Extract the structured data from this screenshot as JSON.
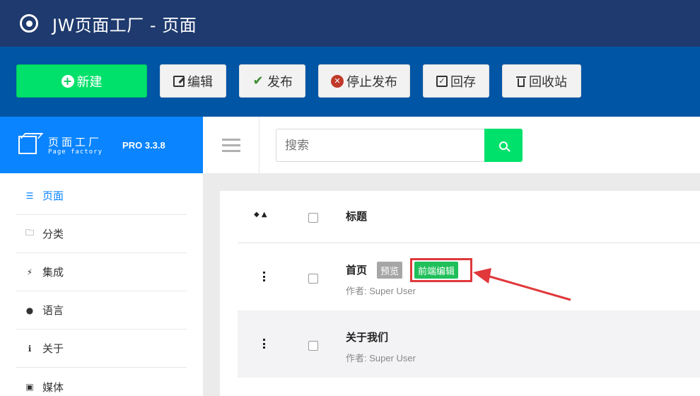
{
  "app": {
    "title": "JW页面工厂 - 页面"
  },
  "toolbar": {
    "new_label": "新建",
    "edit_label": "编辑",
    "publish_label": "发布",
    "unpublish_label": "停止发布",
    "archive_label": "回存",
    "trash_label": "回收站"
  },
  "brand": {
    "name": "页面工厂",
    "subtitle": "Page factory",
    "version": "PRO 3.3.8"
  },
  "sidebar": {
    "items": [
      {
        "label": "页面",
        "icon": "list-icon",
        "active": true
      },
      {
        "label": "分类",
        "icon": "folder-icon"
      },
      {
        "label": "集成",
        "icon": "plug-icon"
      },
      {
        "label": "语言",
        "icon": "globe-icon"
      },
      {
        "label": "关于",
        "icon": "info-icon"
      },
      {
        "label": "媒体",
        "icon": "image-icon"
      }
    ]
  },
  "search": {
    "placeholder": "搜索"
  },
  "table": {
    "header_title": "标题",
    "rows": [
      {
        "title": "首页",
        "preview_label": "预览",
        "frontend_label": "前端编辑",
        "author": "作者: Super User"
      },
      {
        "title": "关于我们",
        "author": "作者: Super User"
      }
    ]
  },
  "colors": {
    "topbar": "#1e3a6e",
    "toolbar": "#0055a5",
    "brand": "#0a84ff",
    "accent_green": "#00e16b",
    "highlight_red": "#e0383b"
  }
}
